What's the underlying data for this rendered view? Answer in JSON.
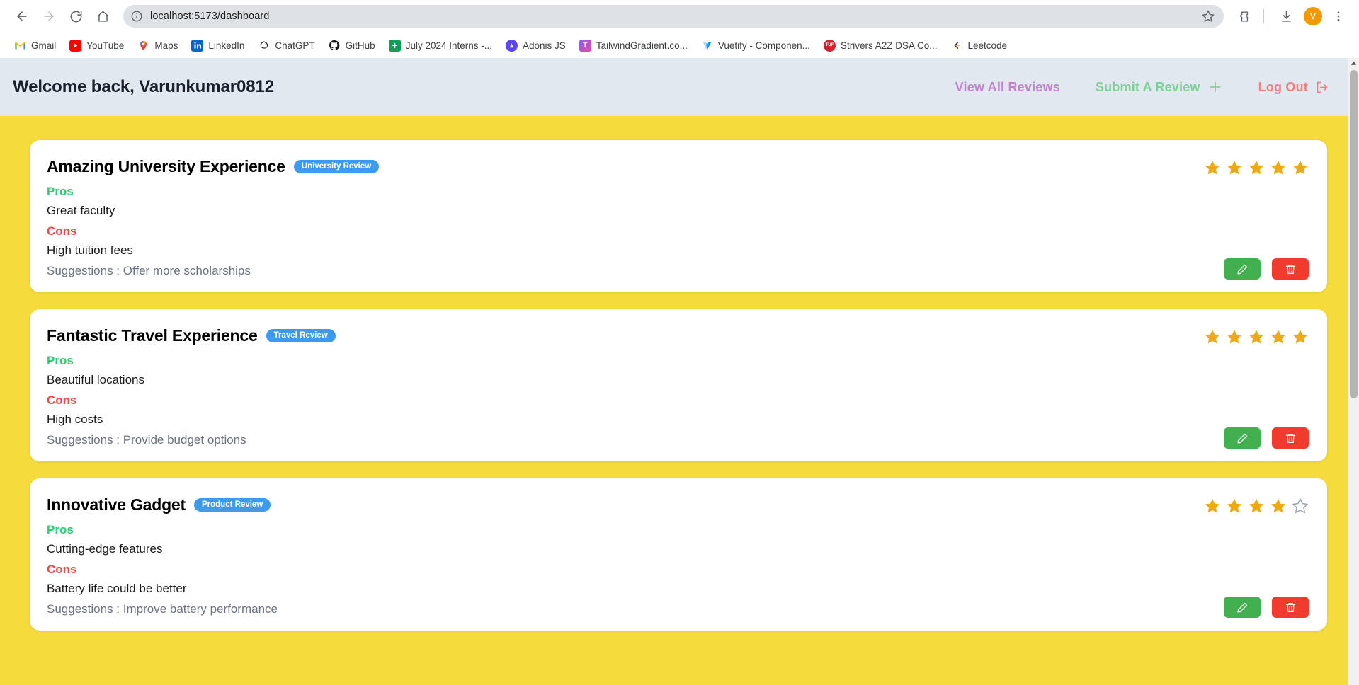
{
  "browser": {
    "back_icon": "arrow-left-icon",
    "forward_icon": "arrow-right-icon",
    "reload_icon": "reload-icon",
    "home_icon": "home-icon",
    "url": "localhost:5173/dashboard",
    "url_placeholder": "Search Google or type a URL",
    "info_icon": "info-circle-icon",
    "bookmark_star_icon": "star-outline-icon",
    "extensions_icon": "extensions-icon",
    "downloads_icon": "download-icon",
    "menu_icon": "three-dot-menu-icon",
    "profile_initial": "V",
    "bookmarks": [
      {
        "label": "Gmail",
        "icon": "gmail-icon",
        "color": "#EA4335"
      },
      {
        "label": "YouTube",
        "icon": "youtube-icon",
        "color": "#FF0000"
      },
      {
        "label": "Maps",
        "icon": "google-maps-icon",
        "color": "#34A853"
      },
      {
        "label": "LinkedIn",
        "icon": "linkedin-icon",
        "color": "#0A66C2"
      },
      {
        "label": "ChatGPT",
        "icon": "chatgpt-icon",
        "color": "#111111"
      },
      {
        "label": "GitHub",
        "icon": "github-icon",
        "color": "#181717"
      },
      {
        "label": "July 2024 Interns -...",
        "icon": "google-sheets-icon",
        "color": "#0F9D58"
      },
      {
        "label": "Adonis JS",
        "icon": "adonisjs-icon",
        "color": "#5A45FF"
      },
      {
        "label": "TailwindGradient.co...",
        "icon": "tailwindgradient-icon",
        "color": "#E0218A"
      },
      {
        "label": "Vuetify - Componen...",
        "icon": "vuetify-icon",
        "color": "#1697F6"
      },
      {
        "label": "Strivers A2Z DSA Co...",
        "icon": "takeuforward-icon",
        "color": "#D32130"
      },
      {
        "label": "Leetcode",
        "icon": "leetcode-icon",
        "color": "#FFA116"
      }
    ]
  },
  "header": {
    "welcome": "Welcome back, Varunkumar0812",
    "nav": {
      "view_all": "View All Reviews",
      "submit": "Submit A Review",
      "submit_icon": "plus-icon",
      "logout": "Log Out",
      "logout_icon": "logout-arrow-icon"
    }
  },
  "labels": {
    "pros": "Pros",
    "cons": "Cons",
    "edit_icon": "pencil-icon",
    "delete_icon": "trash-icon",
    "star_filled_icon": "star-filled-icon",
    "star_empty_icon": "star-outline-icon"
  },
  "colors": {
    "page_background": "#F5DC3C",
    "header_background": "#E2E8F0",
    "badge": "#3B9BF0",
    "pros": "#2ECC71",
    "cons": "#F5484A",
    "star": "#EFAA10",
    "edit_button": "#43B050",
    "delete_button": "#F23B2F",
    "nav_view": "#C084CC",
    "nav_submit": "#7ED196",
    "nav_logout": "#F08080"
  },
  "reviews": [
    {
      "title": "Amazing University Experience",
      "badge": "University Review",
      "pros": "Great faculty",
      "cons": "High tuition fees",
      "suggestion": "Suggestions : Offer more scholarships",
      "rating": 5,
      "max_rating": 5
    },
    {
      "title": "Fantastic Travel Experience",
      "badge": "Travel Review",
      "pros": "Beautiful locations",
      "cons": "High costs",
      "suggestion": "Suggestions : Provide budget options",
      "rating": 5,
      "max_rating": 5
    },
    {
      "title": "Innovative Gadget",
      "badge": "Product Review",
      "pros": "Cutting-edge features",
      "cons": "Battery life could be better",
      "suggestion": "Suggestions : Improve battery performance",
      "rating": 4,
      "max_rating": 5
    }
  ]
}
